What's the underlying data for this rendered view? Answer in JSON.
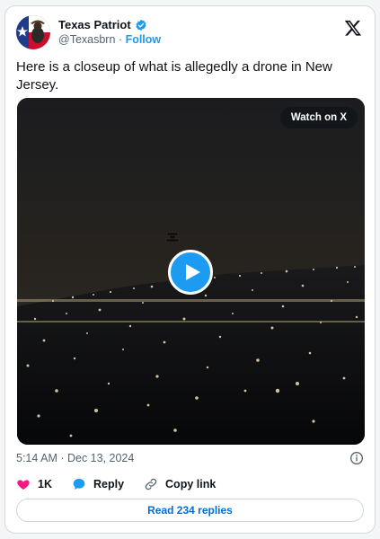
{
  "author": {
    "display_name": "Texas Patriot",
    "handle": "@Texasbrn",
    "separator": "·",
    "follow_label": "Follow"
  },
  "tweet": {
    "text": "Here is a closeup of what is allegedly a drone in New Jersey."
  },
  "media": {
    "watch_label": "Watch on X"
  },
  "meta": {
    "timestamp": "5:14 AM · Dec 13, 2024"
  },
  "actions": {
    "likes": "1K",
    "reply_label": "Reply",
    "copy_link_label": "Copy link"
  },
  "read_replies_label": "Read 234 replies",
  "colors": {
    "accent": "#1d9bf0",
    "like": "#f91880",
    "link": "#006fd6"
  }
}
